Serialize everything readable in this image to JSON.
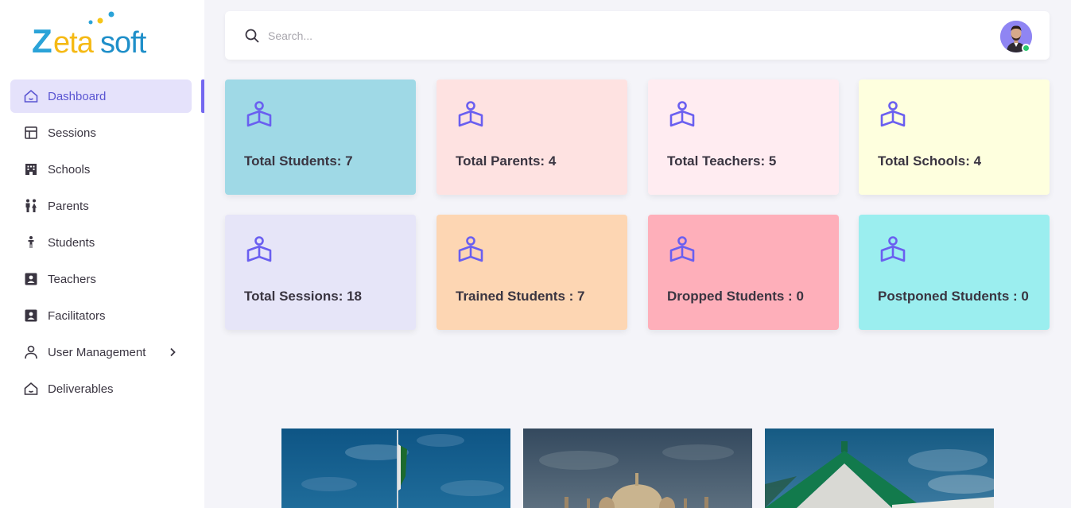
{
  "app": {
    "logo_text": "Zetasoft"
  },
  "sidebar": {
    "items": [
      {
        "label": "Dashboard",
        "icon": "home-icon",
        "active": true
      },
      {
        "label": "Sessions",
        "icon": "layout-icon"
      },
      {
        "label": "Schools",
        "icon": "building-icon"
      },
      {
        "label": "Parents",
        "icon": "family-icon"
      },
      {
        "label": "Students",
        "icon": "person-icon"
      },
      {
        "label": "Teachers",
        "icon": "contact-card-icon"
      },
      {
        "label": "Facilitators",
        "icon": "contact-card-icon"
      },
      {
        "label": "User Management",
        "icon": "user-icon",
        "has_submenu": true
      },
      {
        "label": "Deliverables",
        "icon": "home-icon"
      }
    ]
  },
  "header": {
    "search_placeholder": "Search...",
    "avatar": "user-avatar",
    "online_status_color": "#28c76f"
  },
  "stats": [
    {
      "label": "Total Students: 7",
      "bg": "#9fd9e6"
    },
    {
      "label": "Total Parents: 4",
      "bg": "#fee2e1"
    },
    {
      "label": "Total Teachers: 5",
      "bg": "#ffecf1"
    },
    {
      "label": "Total Schools: 4",
      "bg": "#feffde"
    },
    {
      "label": "Total Sessions: 18",
      "bg": "#e6e5f8"
    },
    {
      "label": "Trained Students : 7",
      "bg": "#fdd6b3"
    },
    {
      "label": "Dropped Students : 0",
      "bg": "#feafba"
    },
    {
      "label": "Postponed Students : 0",
      "bg": "#9beeef"
    }
  ],
  "colors": {
    "accent": "#7367f0",
    "icon": "#6a5ff0",
    "background": "#f4f4f9"
  }
}
